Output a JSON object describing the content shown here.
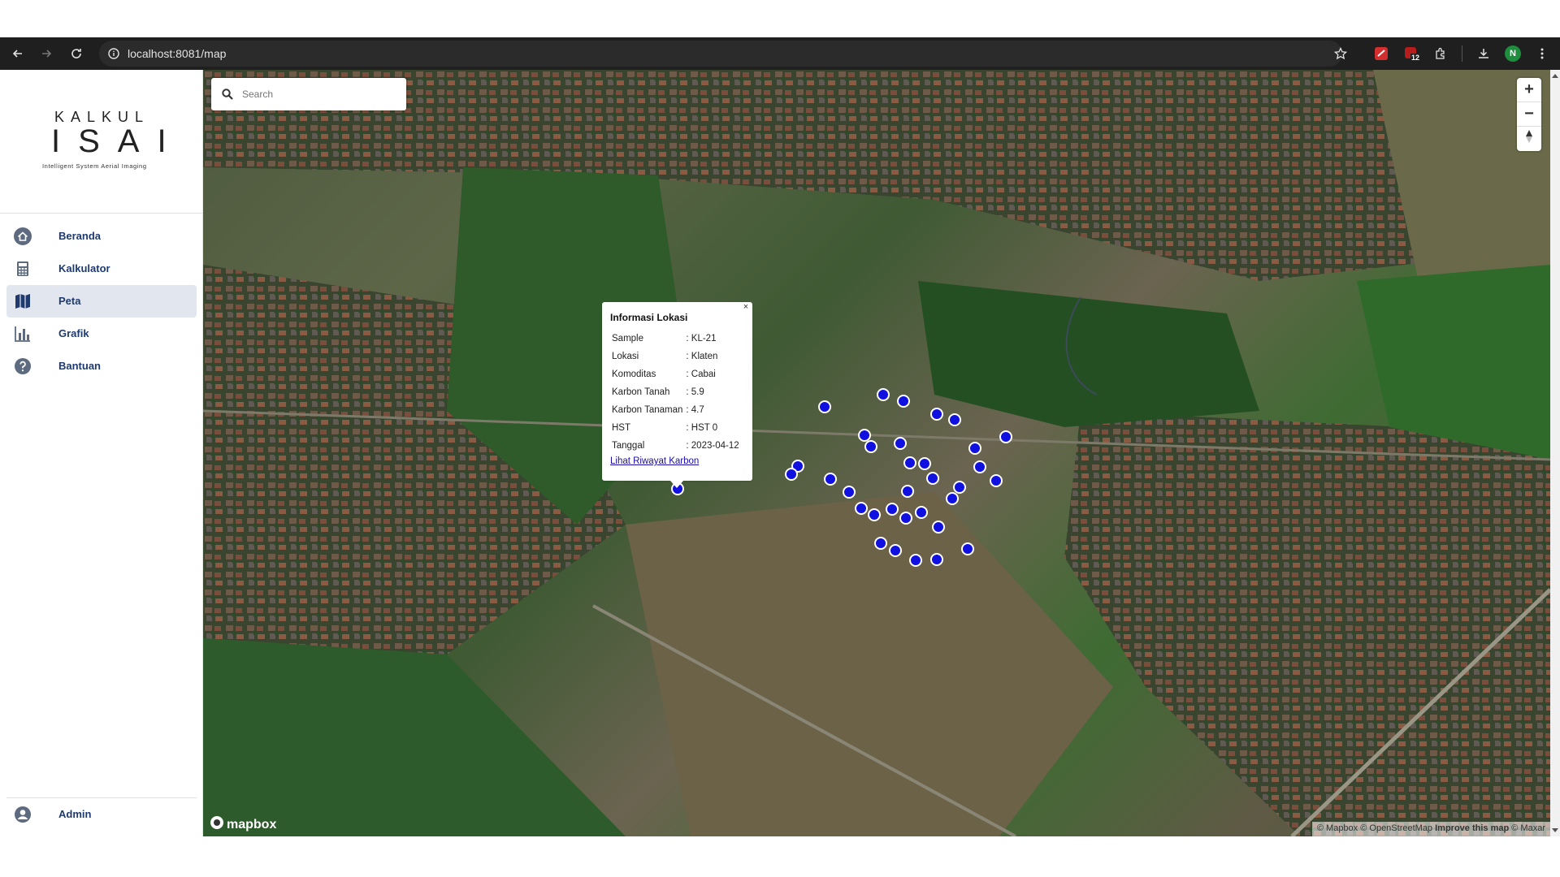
{
  "browser": {
    "url": "localhost:8081/map",
    "profile_initial": "N",
    "extension_badge": "12"
  },
  "sidebar": {
    "logo": {
      "line1": "KALKUL",
      "line2": "ISAI",
      "subtitle": "Intelligent System Aerial Imaging"
    },
    "items": [
      {
        "label": "Beranda",
        "icon": "home-icon"
      },
      {
        "label": "Kalkulator",
        "icon": "calculator-icon"
      },
      {
        "label": "Peta",
        "icon": "map-icon",
        "active": true
      },
      {
        "label": "Grafik",
        "icon": "bar-chart-icon"
      },
      {
        "label": "Bantuan",
        "icon": "help-icon"
      }
    ],
    "footer": {
      "label": "Admin",
      "icon": "account-icon"
    }
  },
  "map": {
    "search_placeholder": "Search",
    "controls": {
      "zoom_in": "+",
      "zoom_out": "−"
    },
    "mapbox_logo": "mapbox",
    "attribution": {
      "mapbox": "© Mapbox",
      "osm": "© OpenStreetMap",
      "improve": "Improve this map",
      "maxar": "© Maxar"
    },
    "marker_color": "#1010e0"
  },
  "popup": {
    "title": "Informasi Lokasi",
    "close": "×",
    "rows": [
      {
        "label": "Sample",
        "value": ": KL-21"
      },
      {
        "label": "Lokasi",
        "value": ": Klaten"
      },
      {
        "label": "Komoditas",
        "value": ": Cabai"
      },
      {
        "label": "Karbon Tanah",
        "value": ": 5.9"
      },
      {
        "label": "Karbon Tanaman",
        "value": ": 4.7"
      },
      {
        "label": "HST",
        "value": ": HST 0"
      },
      {
        "label": "Tanggal",
        "value": ": 2023-04-12"
      }
    ],
    "link": "Lihat Riwayat Karbon"
  }
}
